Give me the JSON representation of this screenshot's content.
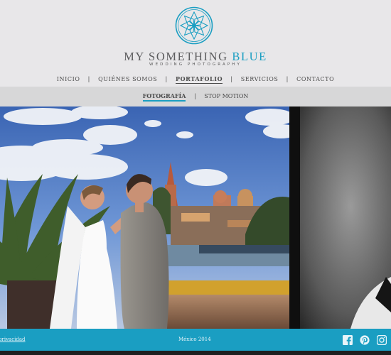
{
  "brand": {
    "name_main": "MY SOMETHING ",
    "name_accent": "BLUE",
    "tagline": "WEDDING PHOTOGRAPHY",
    "accent_color": "#1a9ec2"
  },
  "nav": {
    "items": [
      {
        "label": "INICIO"
      },
      {
        "label": "QUIÉNES SOMOS"
      },
      {
        "label": "PORTAFOLIO",
        "active": true
      },
      {
        "label": "SERVICIOS"
      },
      {
        "label": "CONTACTO"
      }
    ],
    "separator": "|"
  },
  "subnav": {
    "items": [
      {
        "label": "FOTOGRAFÍA",
        "active": true
      },
      {
        "label": "STOP MOTION"
      }
    ],
    "separator": "|"
  },
  "gallery": {
    "images": [
      {
        "icon": "wedding-couple-photo"
      },
      {
        "icon": "black-white-portrait-photo"
      }
    ]
  },
  "footer": {
    "privacy": "privacidad",
    "copyright": "México 2014",
    "social": [
      {
        "icon": "facebook-icon"
      },
      {
        "icon": "pinterest-icon"
      },
      {
        "icon": "instagram-icon"
      }
    ]
  }
}
